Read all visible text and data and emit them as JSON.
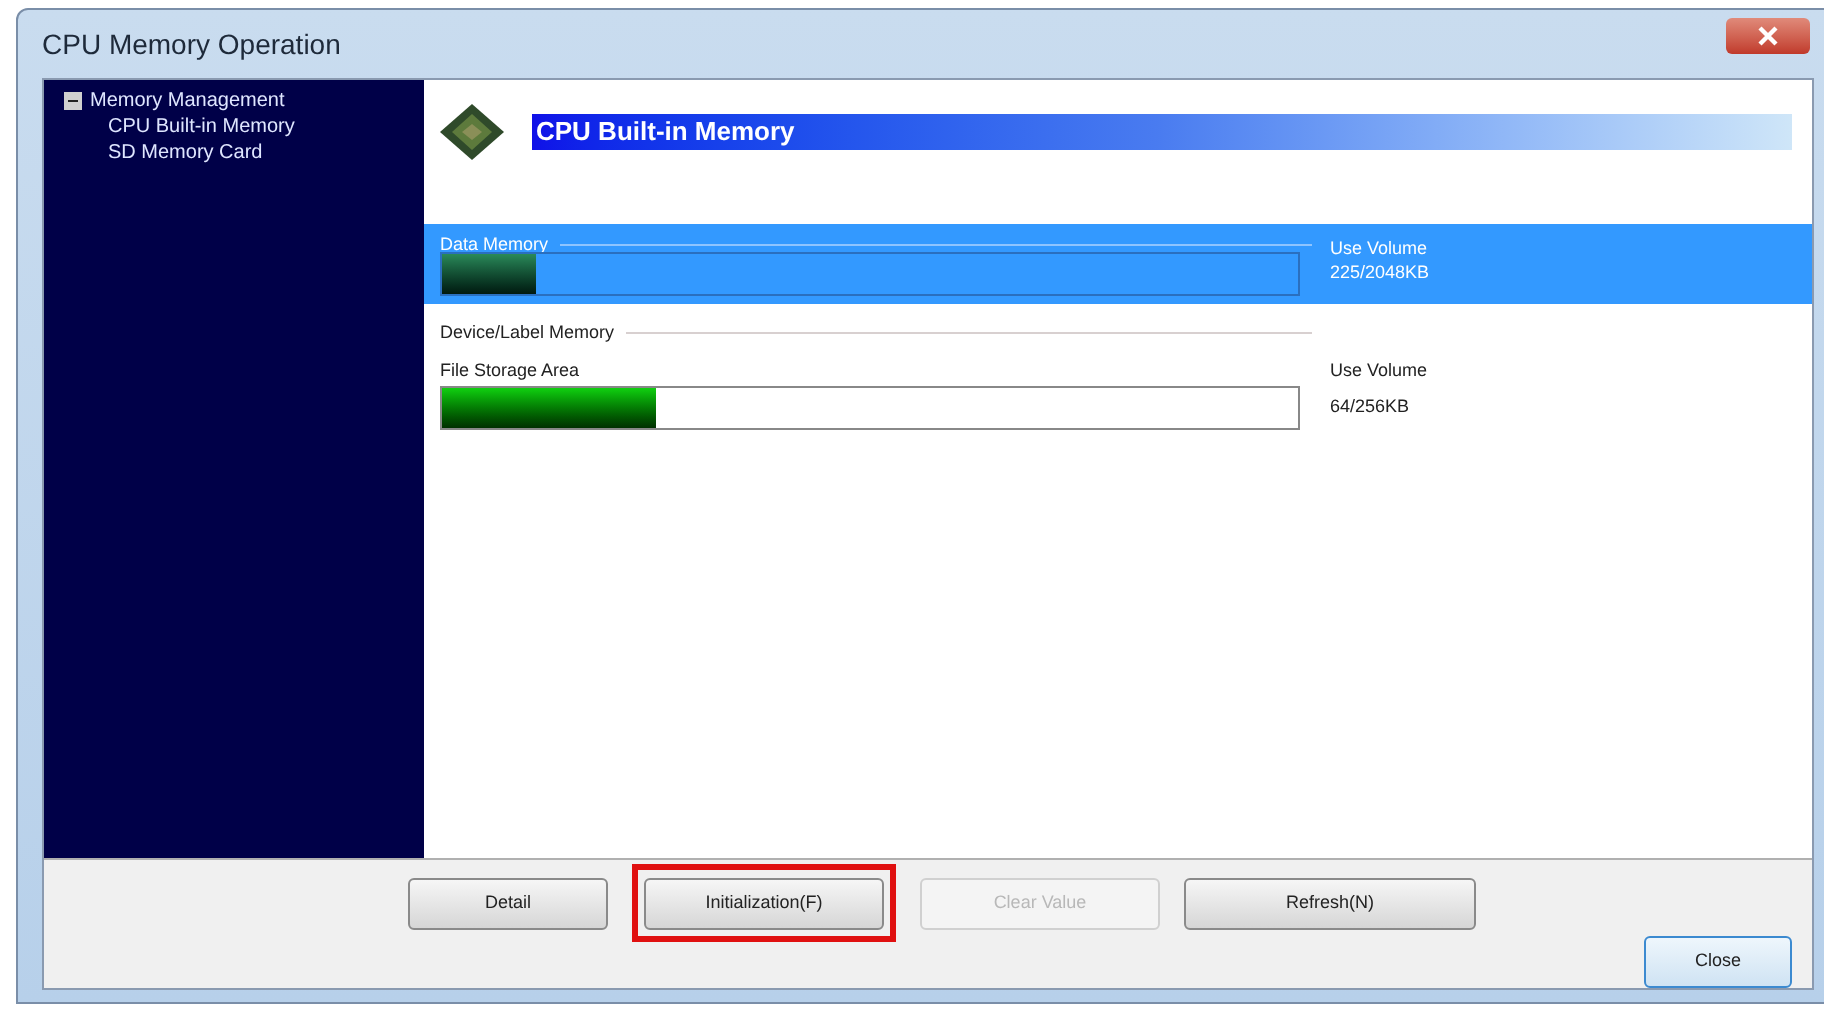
{
  "window": {
    "title": "CPU Memory Operation"
  },
  "tree": [
    {
      "label": "Memory Management",
      "expanded": true,
      "children": [
        {
          "label": "CPU Built-in Memory"
        },
        {
          "label": "SD Memory Card"
        }
      ]
    }
  ],
  "header": {
    "title": "CPU Built-in Memory"
  },
  "sections": [
    {
      "heading": "Data Memory",
      "selected": true,
      "areas": [
        {
          "level": 0.11,
          "use_label": "Use Volume",
          "reading": "225/2048KB"
        }
      ]
    },
    {
      "heading": "Device/Label Memory",
      "selected": false,
      "areas": [
        {
          "label": "File Storage Area",
          "level": 0.25,
          "use_label": "Use Volume",
          "reading": "64/256KB"
        }
      ]
    }
  ],
  "buttons": [
    {
      "label": "Detail",
      "disabled": false,
      "highlighted": false
    },
    {
      "label": "Initialization(F)",
      "disabled": false,
      "highlighted": true
    },
    {
      "label": "Clear Value",
      "disabled": true,
      "highlighted": false
    },
    {
      "label": "Refresh(N)",
      "disabled": false,
      "highlighted": false
    }
  ],
  "close_button": {
    "label": "Close"
  }
}
